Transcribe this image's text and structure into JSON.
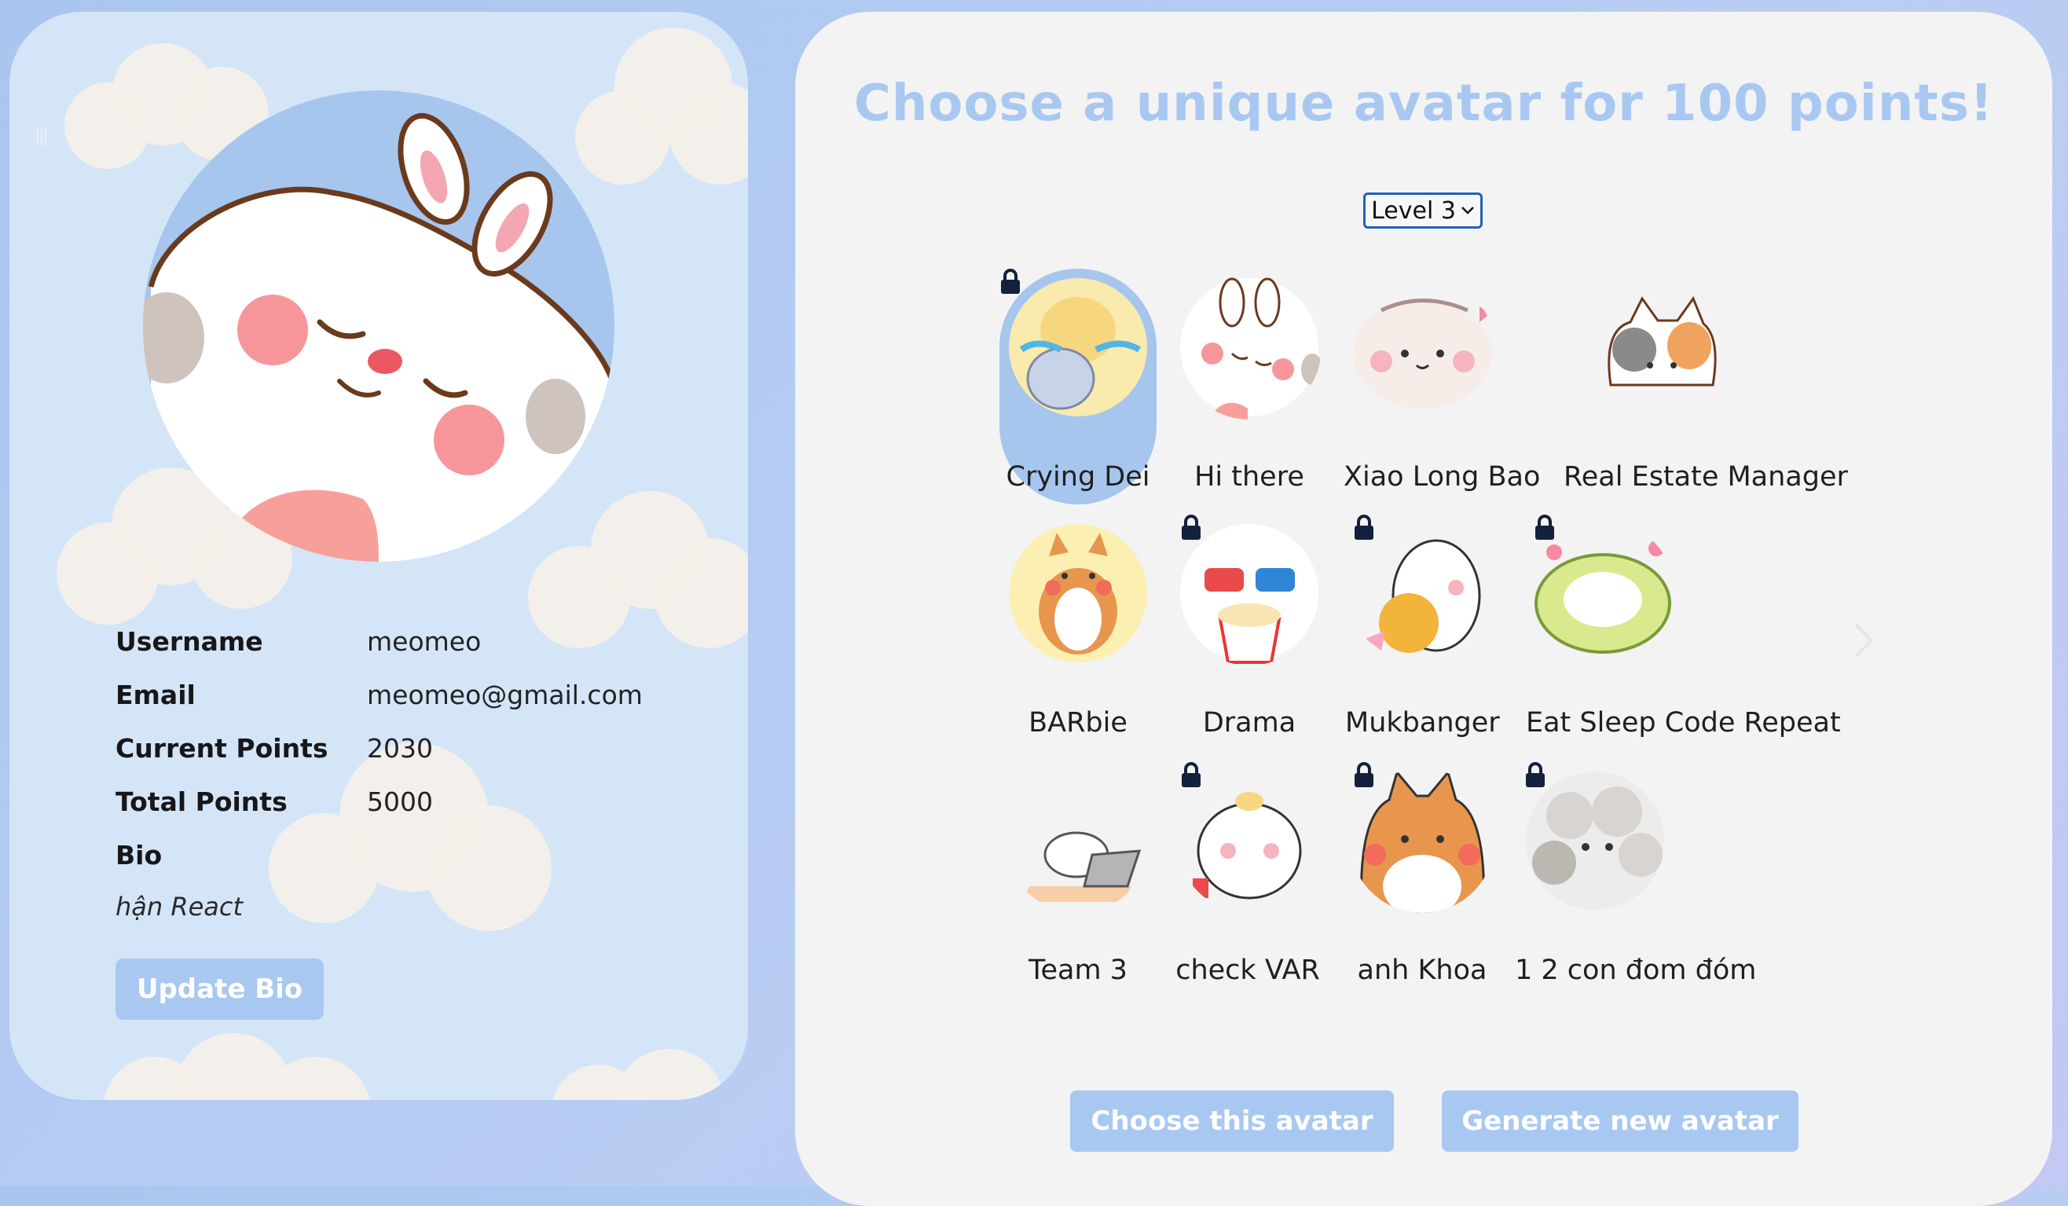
{
  "profile": {
    "fields": [
      {
        "label": "Username",
        "value": "meomeo"
      },
      {
        "label": "Email",
        "value": "meomeo@gmail.com"
      },
      {
        "label": "Current Points",
        "value": "2030"
      },
      {
        "label": "Total Points",
        "value": "5000"
      }
    ],
    "bio_label": "Bio",
    "bio_text": "hận React",
    "update_bio_label": "Update Bio"
  },
  "panel": {
    "title": "Choose a unique avatar for 100 points!",
    "level_select": {
      "selected": "Level 3"
    },
    "avatars": [
      {
        "name": "Crying Dei",
        "locked": true,
        "selected": true
      },
      {
        "name": "Hi there",
        "locked": false,
        "selected": false
      },
      {
        "name": "Xiao Long Bao",
        "locked": false,
        "selected": false
      },
      {
        "name": "Real Estate Manager",
        "locked": false,
        "selected": false
      },
      {
        "name": "BARbie",
        "locked": false,
        "selected": false
      },
      {
        "name": "Drama",
        "locked": true,
        "selected": false
      },
      {
        "name": "Mukbanger",
        "locked": true,
        "selected": false
      },
      {
        "name": "Eat Sleep Code Repeat",
        "locked": true,
        "selected": false
      },
      {
        "name": "Team 3",
        "locked": false,
        "selected": false
      },
      {
        "name": "check VAR",
        "locked": true,
        "selected": false
      },
      {
        "name": "anh Khoa",
        "locked": true,
        "selected": false
      },
      {
        "name": "1 2 con đom đóm",
        "locked": true,
        "selected": false
      }
    ],
    "choose_label": "Choose this avatar",
    "generate_label": "Generate new avatar"
  },
  "colors": {
    "accent": "#a8c8f2",
    "select_border": "#1e64b4",
    "panel_bg": "#f3f3f3",
    "card_bg": "#d5e5f8"
  },
  "icons": [
    "lock-icon",
    "chevron-down-icon",
    "chevron-right-icon"
  ]
}
